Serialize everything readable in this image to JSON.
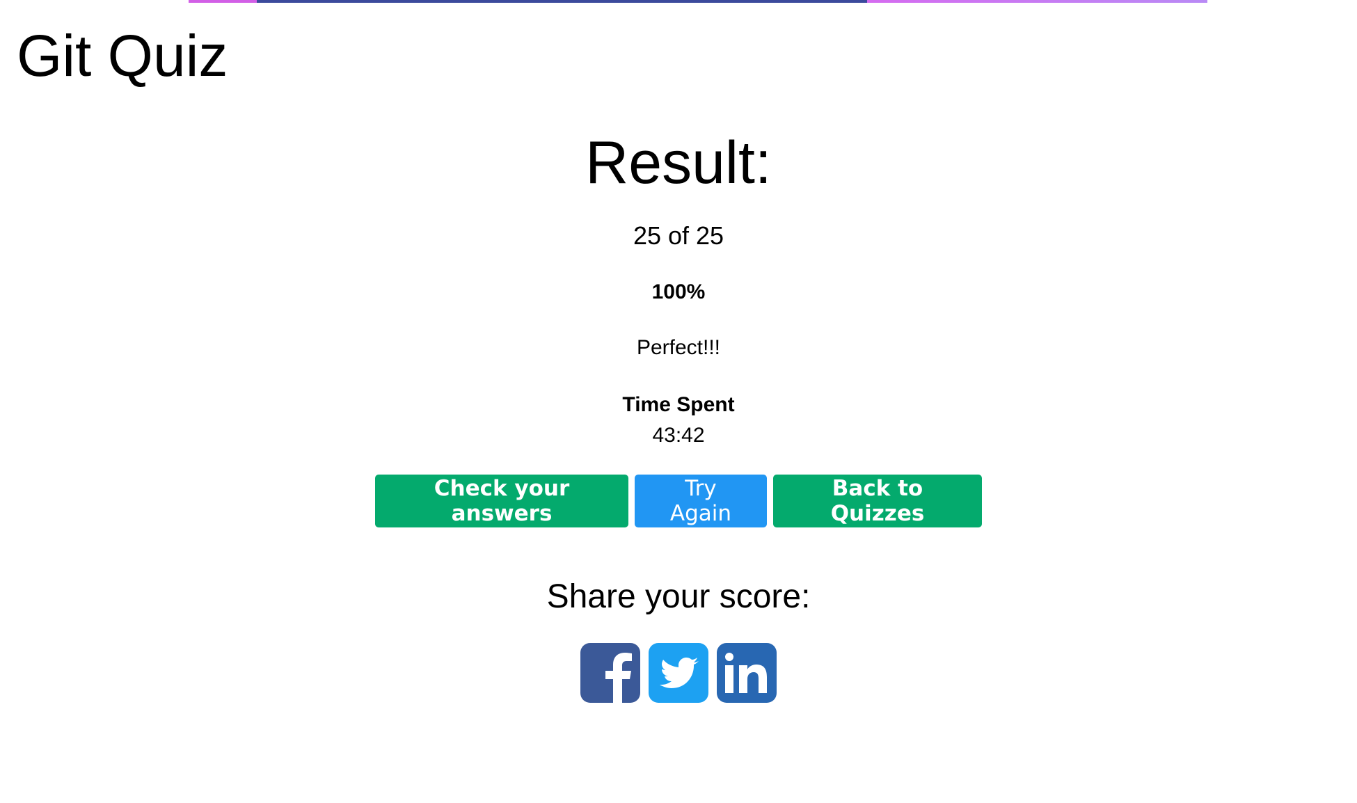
{
  "colors": {
    "progress_left": "#d25fe6",
    "progress_mid": "#3b4a9c",
    "progress_right_start": "#d56bf0",
    "progress_right_end": "#b98af5",
    "btn_green": "#04aa6d",
    "btn_blue": "#2196f3",
    "facebook": "#3b5998",
    "twitter": "#1da1f2",
    "linkedin": "#2867b2"
  },
  "page_title": "Git Quiz",
  "result": {
    "heading": "Result:",
    "score": "25 of 25",
    "percent": "100%",
    "progress_fraction": 1.0,
    "feedback": "Perfect!!!",
    "time_label": "Time Spent",
    "time_value": "43:42"
  },
  "actions": {
    "check_label": "Check your answers",
    "try_label": "Try Again",
    "back_label": "Back to Quizzes"
  },
  "share": {
    "heading": "Share your score:",
    "icons": [
      "facebook-icon",
      "twitter-icon",
      "linkedin-icon"
    ]
  }
}
